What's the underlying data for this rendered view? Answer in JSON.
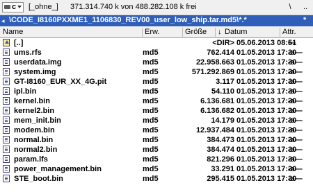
{
  "drive": {
    "letter": "c",
    "label": "[_ohne_]",
    "free_space": "371.314.740 k von 488.282.108 k frei"
  },
  "toolbar": {
    "root": "\\",
    "up": ".."
  },
  "path": {
    "history_glyph": "◂",
    "text": "\\CODE_I8160PXXME1_1106830_REV00_user_low_ship.tar.md5\\*.*",
    "star": "*"
  },
  "columns": {
    "name": "Name",
    "ext": "Erw.",
    "size": "Größe",
    "date": "Datum",
    "attr": "Attr.",
    "sort_glyph": "↓"
  },
  "files": [
    {
      "name": "[..]",
      "ext": "",
      "size": "<DIR>",
      "date": "05.06.2013 08:51",
      "attr": "—",
      "up": true
    },
    {
      "name": "ums.rfs",
      "ext": "md5",
      "size": "762.414",
      "date": "01.05.2013 17:30",
      "attr": "-a—"
    },
    {
      "name": "userdata.img",
      "ext": "md5",
      "size": "22.958.663",
      "date": "01.05.2013 17:30",
      "attr": "-a—"
    },
    {
      "name": "system.img",
      "ext": "md5",
      "size": "571.292.869",
      "date": "01.05.2013 17:30",
      "attr": "-a—"
    },
    {
      "name": "GT-I8160_EUR_XX_4G.pit",
      "ext": "md5",
      "size": "3.117",
      "date": "01.05.2013 17:30",
      "attr": "-a—"
    },
    {
      "name": "ipl.bin",
      "ext": "md5",
      "size": "54.110",
      "date": "01.05.2013 17:30",
      "attr": "-a—"
    },
    {
      "name": "kernel.bin",
      "ext": "md5",
      "size": "6.136.681",
      "date": "01.05.2013 17:30",
      "attr": "-a—"
    },
    {
      "name": "kernel2.bin",
      "ext": "md5",
      "size": "6.136.682",
      "date": "01.05.2013 17:30",
      "attr": "-a—"
    },
    {
      "name": "mem_init.bin",
      "ext": "md5",
      "size": "14.179",
      "date": "01.05.2013 17:30",
      "attr": "-a—"
    },
    {
      "name": "modem.bin",
      "ext": "md5",
      "size": "12.937.484",
      "date": "01.05.2013 17:30",
      "attr": "-a—"
    },
    {
      "name": "normal.bin",
      "ext": "md5",
      "size": "384.473",
      "date": "01.05.2013 17:30",
      "attr": "-a—"
    },
    {
      "name": "normal2.bin",
      "ext": "md5",
      "size": "384.474",
      "date": "01.05.2013 17:30",
      "attr": "-a—"
    },
    {
      "name": "param.lfs",
      "ext": "md5",
      "size": "821.296",
      "date": "01.05.2013 17:30",
      "attr": "-a—"
    },
    {
      "name": "power_management.bin",
      "ext": "md5",
      "size": "33.291",
      "date": "01.05.2013 17:30",
      "attr": "-a—"
    },
    {
      "name": "STE_boot.bin",
      "ext": "md5",
      "size": "295.415",
      "date": "01.05.2013 17:30",
      "attr": "-a—"
    }
  ],
  "colors": {
    "path_bar": "#2f5fb8",
    "header_bg": "#f0f0f0"
  }
}
